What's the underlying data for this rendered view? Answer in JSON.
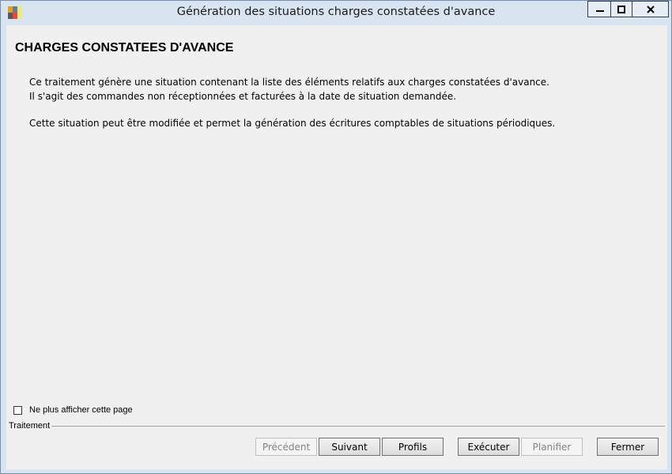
{
  "window": {
    "title": "Génération des situations charges constatées d'avance",
    "controls": {
      "minimize_icon": "minimize-icon",
      "maximize_icon": "maximize-icon",
      "close_icon": "close-icon"
    }
  },
  "content": {
    "heading": "CHARGES CONSTATEES D'AVANCE",
    "paragraphs": [
      "Ce traitement génère une situation contenant la liste des éléments relatifs aux charges constatées d'avance.",
      "Il s'agit des commandes non réceptionnées et facturées à la date de situation demandée.",
      "Cette situation peut être modifiée et permet la génération des écritures comptables de situations périodiques."
    ]
  },
  "footer": {
    "checkbox_label": "Ne plus afficher cette page",
    "checkbox_checked": false,
    "group_label": "Traitement",
    "buttons": {
      "precedent": "Précédent",
      "suivant": "Suivant",
      "profils": "Profils",
      "executer": "Exécuter",
      "planifier": "Planifier",
      "fermer": "Fermer"
    }
  }
}
